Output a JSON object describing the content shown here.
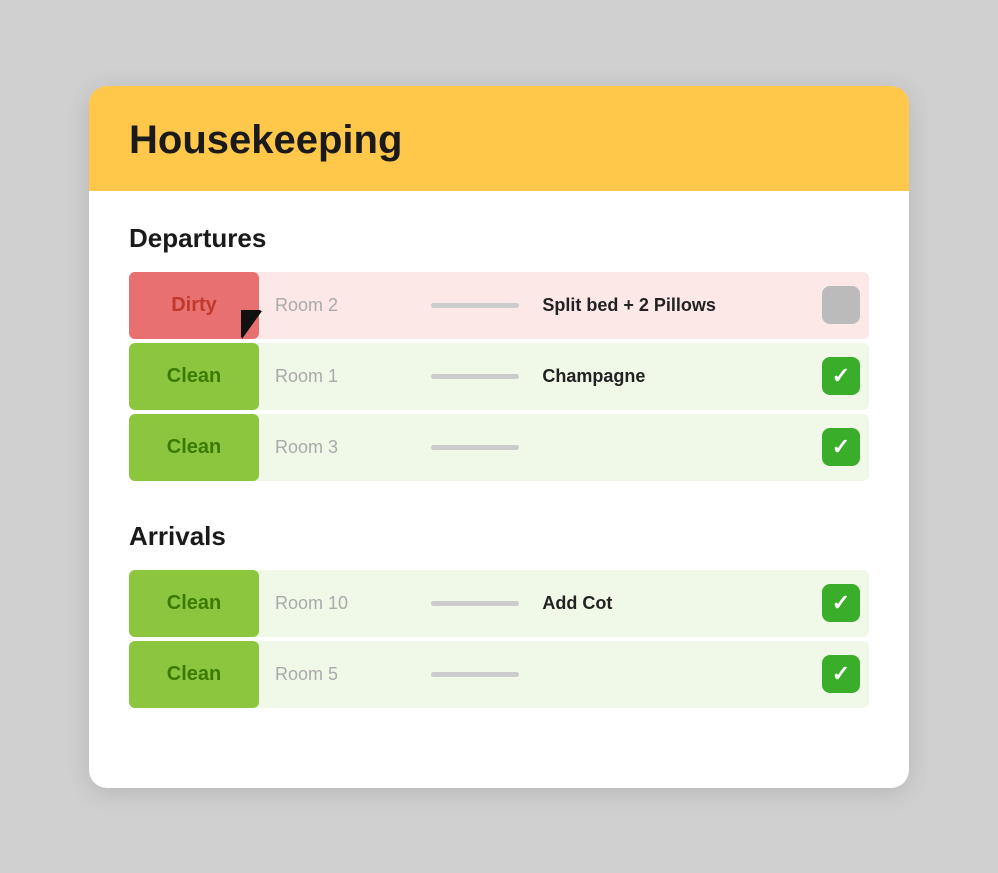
{
  "header": {
    "title": "Housekeeping"
  },
  "departures": {
    "section_title": "Departures",
    "rows": [
      {
        "status": "Dirty",
        "status_type": "dirty",
        "room": "Room 2",
        "note": "Split bed + 2 Pillows",
        "checked": false
      },
      {
        "status": "Clean",
        "status_type": "clean",
        "room": "Room 1",
        "note": "Champagne",
        "checked": true
      },
      {
        "status": "Clean",
        "status_type": "clean",
        "room": "Room 3",
        "note": "",
        "checked": true
      }
    ]
  },
  "arrivals": {
    "section_title": "Arrivals",
    "rows": [
      {
        "status": "Clean",
        "status_type": "clean",
        "room": "Room 10",
        "note": "Add Cot",
        "checked": true
      },
      {
        "status": "Clean",
        "status_type": "clean",
        "room": "Room 5",
        "note": "",
        "checked": true
      }
    ]
  },
  "checkmark": "✓"
}
